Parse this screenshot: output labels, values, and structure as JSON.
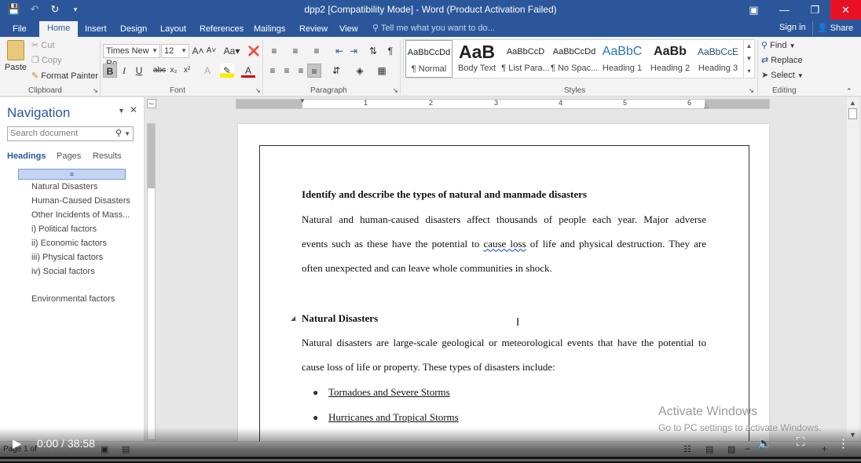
{
  "titlebar": {
    "title": "dpp2 [Compatibility Mode] - Word (Product Activation Failed)",
    "qat": {
      "save_icon": "save-icon",
      "undo_icon": "undo-icon",
      "redo_icon": "redo-icon"
    }
  },
  "tabs": [
    {
      "label": "File"
    },
    {
      "label": "Home"
    },
    {
      "label": "Insert"
    },
    {
      "label": "Design"
    },
    {
      "label": "Layout"
    },
    {
      "label": "References"
    },
    {
      "label": "Mailings"
    },
    {
      "label": "Review"
    },
    {
      "label": "View"
    }
  ],
  "tell_me": "Tell me what you want to do...",
  "sign_in": "Sign in",
  "share": "Share",
  "ribbon": {
    "clipboard": {
      "paste": "Paste",
      "cut": "Cut",
      "copy": "Copy",
      "format_painter": "Format Painter",
      "label": "Clipboard"
    },
    "font": {
      "name": "Times New Ro",
      "size": "12",
      "label": "Font"
    },
    "paragraph": {
      "label": "Paragraph"
    },
    "styles": {
      "label": "Styles",
      "items": [
        {
          "preview": "AaBbCcDd",
          "name": "¶ Normal"
        },
        {
          "preview": "AaB",
          "name": "Body Text"
        },
        {
          "preview": "AaBbCcD",
          "name": "¶ List Para..."
        },
        {
          "preview": "AaBbCcDd",
          "name": "¶ No Spac..."
        },
        {
          "preview": "AaBbC",
          "name": "Heading 1"
        },
        {
          "preview": "AaBb",
          "name": "Heading 2"
        },
        {
          "preview": "AaBbCcE",
          "name": "Heading 3"
        }
      ]
    },
    "editing": {
      "find": "Find",
      "replace": "Replace",
      "select": "Select",
      "label": "Editing"
    }
  },
  "nav": {
    "title": "Navigation",
    "search_placeholder": "Search document",
    "tabs": [
      "Headings",
      "Pages",
      "Results"
    ],
    "headings": [
      "Natural Disasters",
      "Human-Caused Disasters",
      "Other Incidents of Mass...",
      "i) Political factors",
      "ii) Economic factors",
      "iii) Physical factors",
      "iv) Social factors",
      "Environmental factors"
    ]
  },
  "ruler": {
    "numbers": [
      "1",
      "2",
      "3",
      "4",
      "5",
      "6"
    ]
  },
  "document": {
    "heading1": "Identify and describe the types of natural and manmade disasters",
    "para1_line1": "Natural and human-caused disasters affect thousands of people each year. Major adverse",
    "para1_line2a": "events such as these have the potential to ",
    "para1_line2b": "cause  loss",
    "para1_line2c": " of life and physical destruction. They are",
    "para1_line3": "often unexpected and can leave whole communities in shock.",
    "heading2": "Natural Disasters",
    "para2_line1": "Natural disasters are large-scale geological or meteorological events that have the potential to",
    "para2_line2": "cause loss of life or property. These types of disasters include:",
    "bullets": [
      "Tornadoes and Severe Storms",
      "Hurricanes and Tropical Storms"
    ]
  },
  "watermark": {
    "line1": "Activate Windows",
    "line2": "Go to PC settings to activate Windows."
  },
  "status": {
    "page": "Page 1 of"
  },
  "video": {
    "time": "0:00 / 38:58"
  }
}
